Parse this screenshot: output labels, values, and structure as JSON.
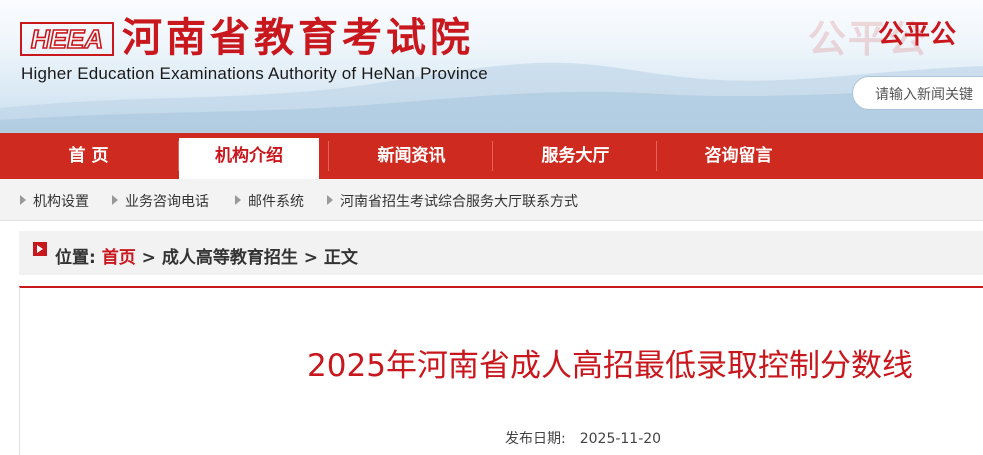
{
  "header": {
    "logo_mark": "HEEA",
    "title_cn": "河南省教育考试院",
    "title_en": "Higher Education Examinations Authority of HeNan Province",
    "slogan_bg": "公平公",
    "slogan": "公平公",
    "search_placeholder": "请输入新闻关键"
  },
  "nav": {
    "items": [
      {
        "label": "首 页"
      },
      {
        "label": "机构介绍"
      },
      {
        "label": "新闻资讯"
      },
      {
        "label": "服务大厅"
      },
      {
        "label": "咨询留言"
      }
    ],
    "active_index": 1
  },
  "subnav": {
    "items": [
      {
        "label": "机构设置"
      },
      {
        "label": "业务咨询电话"
      },
      {
        "label": "邮件系统"
      },
      {
        "label": "河南省招生考试综合服务大厅联系方式"
      }
    ]
  },
  "breadcrumb": {
    "prefix": "位置:",
    "home": "首页",
    "sep1": ">",
    "section": "成人高等教育招生",
    "sep2": ">",
    "current": "正文"
  },
  "article": {
    "title": "2025年河南省成人高招最低录取控制分数线",
    "date_label": "发布日期:",
    "date_value": "2025-11-20"
  },
  "colors": {
    "brand_red": "#c8171d",
    "nav_red": "#cf2a1f"
  }
}
